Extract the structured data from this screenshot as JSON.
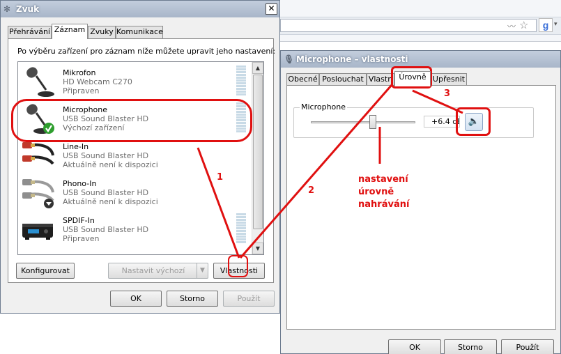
{
  "browser": {
    "rss_icon": "rss-icon",
    "star_icon": "star-icon",
    "search_engine_icon": "google-icon"
  },
  "sound_dialog": {
    "title": "Zvuk",
    "tabs": [
      {
        "label": "Přehrávání",
        "active": false
      },
      {
        "label": "Záznam",
        "active": true
      },
      {
        "label": "Zvuky",
        "active": false
      },
      {
        "label": "Komunikace",
        "active": false
      }
    ],
    "instruction": "Po výběru zařízení pro záznam níže můžete upravit jeho nastavení:",
    "devices": [
      {
        "name": "Mikrofon",
        "device": "HD Webcam C270",
        "status": "Připraven",
        "icon": "microphone-icon"
      },
      {
        "name": "Microphone",
        "device": "USB Sound Blaster HD",
        "status": "Výchozí zařízení",
        "icon": "microphone-default-icon"
      },
      {
        "name": "Line-In",
        "device": "USB Sound Blaster HD",
        "status": "Aktuálně není k dispozici",
        "icon": "rca-cable-icon"
      },
      {
        "name": "Phono-In",
        "device": "USB Sound Blaster HD",
        "status": "Aktuálně není k dispozici",
        "icon": "rca-cable-down-icon"
      },
      {
        "name": "SPDIF-In",
        "device": "USB Sound Blaster HD",
        "status": "Připraven",
        "icon": "spdif-device-icon"
      }
    ],
    "configure_label": "Konfigurovat",
    "set_default_label": "Nastavit výchozí",
    "properties_label": "Vlastnosti",
    "ok_label": "OK",
    "cancel_label": "Storno",
    "apply_label": "Použít"
  },
  "mic_dialog": {
    "title": "Microphone – vlastnosti",
    "tabs": [
      {
        "label": "Obecné",
        "active": false
      },
      {
        "label": "Poslouchat",
        "active": false
      },
      {
        "label": "Vlastn",
        "active": false
      },
      {
        "label": "Úrovně",
        "active": true
      },
      {
        "label": "Upřesnit",
        "active": false
      }
    ],
    "group_label": "Microphone",
    "level_value": "+6.4 dB",
    "level_fraction": 0.6,
    "ok_label": "OK",
    "cancel_label": "Storno",
    "apply_label": "Použít"
  },
  "annotations": {
    "step1": "1",
    "step2": "2",
    "step3": "3",
    "note_line1": "nastavení",
    "note_line2": "úrovně",
    "note_line3": "nahrávání",
    "color": "#e01010"
  }
}
